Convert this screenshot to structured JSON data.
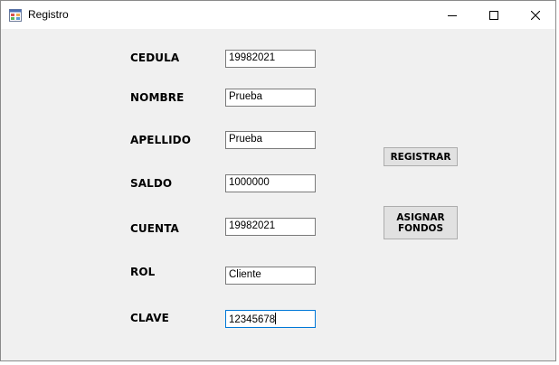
{
  "window": {
    "title": "Registro",
    "icons": {
      "app": "form-app-icon",
      "minimize": "minimize-icon",
      "maximize": "maximize-icon",
      "close": "close-icon"
    }
  },
  "form": {
    "fields": [
      {
        "label": "CEDULA",
        "value": "19982021"
      },
      {
        "label": "NOMBRE",
        "value": "Prueba"
      },
      {
        "label": "APELLIDO",
        "value": "Prueba"
      },
      {
        "label": "SALDO",
        "value": "1000000"
      },
      {
        "label": "CUENTA",
        "value": "19982021"
      },
      {
        "label": "ROL",
        "value": "Cliente"
      },
      {
        "label": "CLAVE",
        "value": "12345678"
      }
    ]
  },
  "buttons": {
    "registrar": "REGISTRAR",
    "asignar_line1": "ASIGNAR",
    "asignar_line2": "FONDOS"
  },
  "colors": {
    "background": "#f0f0f0",
    "focus_border": "#0078d7",
    "button_face": "#e1e1e1"
  }
}
